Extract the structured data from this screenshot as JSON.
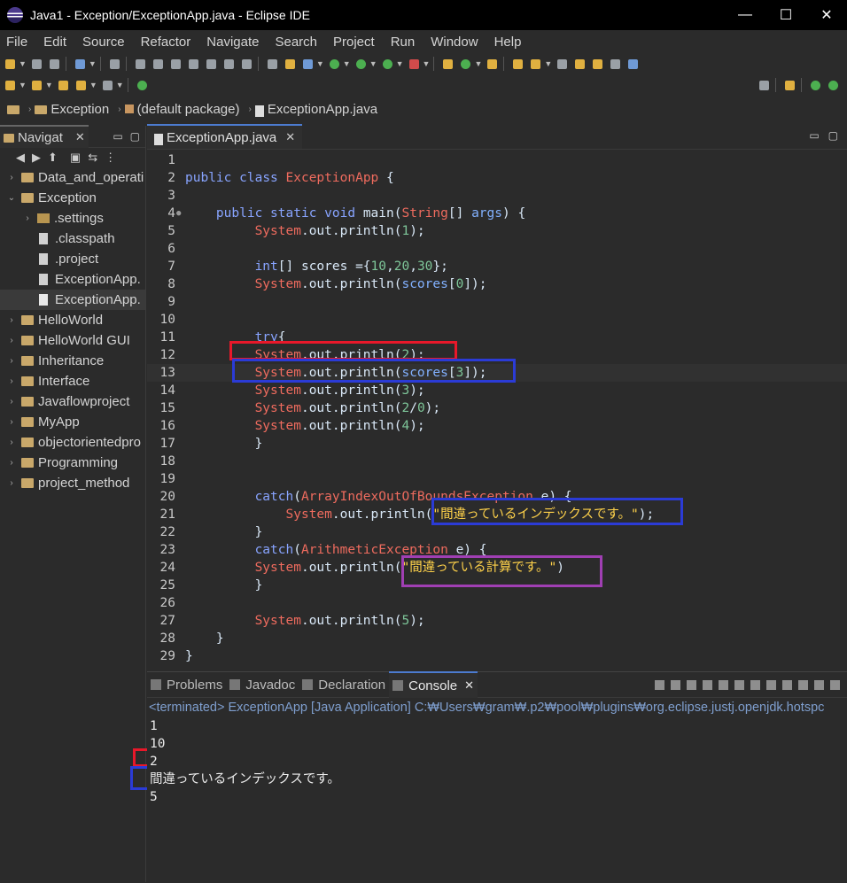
{
  "window": {
    "title": "Java1 - Exception/ExceptionApp.java - Eclipse IDE",
    "minimize": "—",
    "maximize": "☐",
    "close": "✕"
  },
  "menu": [
    "File",
    "Edit",
    "Source",
    "Refactor",
    "Navigate",
    "Search",
    "Project",
    "Run",
    "Window",
    "Help"
  ],
  "breadcrumb": {
    "project": "Exception",
    "package": "(default package)",
    "file": "ExceptionApp.java"
  },
  "navigator": {
    "tab_label": "Navigat",
    "items": [
      {
        "label": "Data_and_operati",
        "depth": 0,
        "expanded": false,
        "type": "project"
      },
      {
        "label": "Exception",
        "depth": 0,
        "expanded": true,
        "type": "project"
      },
      {
        "label": ".settings",
        "depth": 1,
        "expanded": false,
        "type": "folder"
      },
      {
        "label": ".classpath",
        "depth": 1,
        "type": "file"
      },
      {
        "label": ".project",
        "depth": 1,
        "type": "file"
      },
      {
        "label": "ExceptionApp.",
        "depth": 1,
        "type": "class"
      },
      {
        "label": "ExceptionApp.",
        "depth": 1,
        "type": "java",
        "selected": true
      },
      {
        "label": "HelloWorld",
        "depth": 0,
        "expanded": false,
        "type": "project"
      },
      {
        "label": "HelloWorld GUI",
        "depth": 0,
        "expanded": false,
        "type": "project"
      },
      {
        "label": "Inheritance",
        "depth": 0,
        "expanded": false,
        "type": "project"
      },
      {
        "label": "Interface",
        "depth": 0,
        "expanded": false,
        "type": "project"
      },
      {
        "label": "Javaflowproject",
        "depth": 0,
        "expanded": false,
        "type": "project"
      },
      {
        "label": "MyApp",
        "depth": 0,
        "expanded": false,
        "type": "project"
      },
      {
        "label": "objectorientedpro",
        "depth": 0,
        "expanded": false,
        "type": "project"
      },
      {
        "label": "Programming",
        "depth": 0,
        "expanded": false,
        "type": "project"
      },
      {
        "label": "project_method",
        "depth": 0,
        "expanded": false,
        "type": "project"
      }
    ]
  },
  "editor": {
    "tab_label": "ExceptionApp.java",
    "current_line": 13,
    "lines": [
      {
        "n": "1",
        "html": ""
      },
      {
        "n": "2",
        "html": "<span class=\"k\">public</span> <span class=\"k\">class</span> <span class=\"cls\">ExceptionApp</span> {"
      },
      {
        "n": "3",
        "html": ""
      },
      {
        "n": "4",
        "html": "    <span class=\"k\">public</span> <span class=\"k\">static</span> <span class=\"k\">void</span> main(<span class=\"cls\">String</span>[] <span class=\"var\">args</span>) {"
      },
      {
        "n": "5",
        "html": "         <span class=\"sys\">System</span>.out.println(<span class=\"num\">1</span>);"
      },
      {
        "n": "6",
        "html": ""
      },
      {
        "n": "7",
        "html": "         <span class=\"k\">int</span>[] scores ={<span class=\"num\">10</span>,<span class=\"num\">20</span>,<span class=\"num\">30</span>};"
      },
      {
        "n": "8",
        "html": "         <span class=\"sys\">System</span>.out.println(<span class=\"var\">scores</span>[<span class=\"num\">0</span>]);"
      },
      {
        "n": "9",
        "html": ""
      },
      {
        "n": "10",
        "html": ""
      },
      {
        "n": "11",
        "html": "         <span class=\"k\">try</span>{"
      },
      {
        "n": "12",
        "html": "         <span class=\"sys\">System</span>.out.println(<span class=\"num\">2</span>);"
      },
      {
        "n": "13",
        "html": "         <span class=\"sys\">System</span>.out.println(<span class=\"var\">scores</span>[<span class=\"num\">3</span>]);"
      },
      {
        "n": "14",
        "html": "         <span class=\"sys\">System</span>.out.println(<span class=\"num\">3</span>);"
      },
      {
        "n": "15",
        "html": "         <span class=\"sys\">System</span>.out.println(<span class=\"num\">2</span>/<span class=\"num\">0</span>);"
      },
      {
        "n": "16",
        "html": "         <span class=\"sys\">System</span>.out.println(<span class=\"num\">4</span>);"
      },
      {
        "n": "17",
        "html": "         }"
      },
      {
        "n": "18",
        "html": ""
      },
      {
        "n": "19",
        "html": ""
      },
      {
        "n": "20",
        "html": "         <span class=\"k\">catch</span>(<span class=\"cls\">ArrayIndexOutOfBoundsException</span> e) {"
      },
      {
        "n": "21",
        "html": "             <span class=\"sys\">System</span>.out.println(<span class=\"str\">\"間違っているインデックスです。\"</span>);"
      },
      {
        "n": "22",
        "html": "         }"
      },
      {
        "n": "23",
        "html": "         <span class=\"k\">catch</span>(<span class=\"cls\">ArithmeticException</span> e) {"
      },
      {
        "n": "24",
        "html": "         <span class=\"sys\">System</span>.out.println(<span class=\"str\">\"間違っている計算です。\"</span>)"
      },
      {
        "n": "25",
        "html": "         }"
      },
      {
        "n": "26",
        "html": ""
      },
      {
        "n": "27",
        "html": "         <span class=\"sys\">System</span>.out.println(<span class=\"num\">5</span>);"
      },
      {
        "n": "28",
        "html": "    }"
      },
      {
        "n": "29",
        "html": "}"
      }
    ]
  },
  "console": {
    "tabs": [
      "Problems",
      "Javadoc",
      "Declaration",
      "Console"
    ],
    "active_tab": "Console",
    "status": "<terminated> ExceptionApp [Java Application] C:₩Users₩gram₩.p2₩pool₩plugins₩org.eclipse.justj.openjdk.hotspc",
    "output": [
      "1",
      "10",
      "2",
      "間違っているインデックスです。",
      "5"
    ]
  },
  "annotation_colors": {
    "red": "#e8182a",
    "blue": "#2b3bd6",
    "purple": "#a03fb3"
  }
}
